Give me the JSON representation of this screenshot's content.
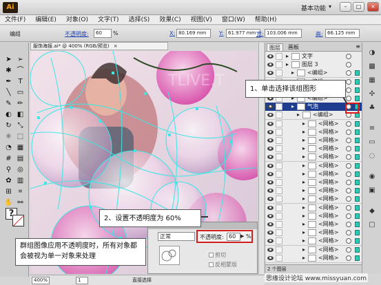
{
  "app": {
    "logo": "Ai",
    "layout_label": "基本功能",
    "window_buttons": {
      "minimize": "–",
      "maximize": "□",
      "close": "×"
    }
  },
  "menu": [
    "文件(F)",
    "编辑(E)",
    "对象(O)",
    "文字(T)",
    "选择(S)",
    "效果(C)",
    "视图(V)",
    "窗口(W)",
    "帮助(H)"
  ],
  "control_bar": {
    "selection_label": "编组",
    "opacity_label": "不透明度:",
    "opacity_value": "60",
    "opacity_unit": "%",
    "x_label": "X:",
    "x_value": "80.169 mm",
    "y_label": "Y:",
    "y_value": "61.977 mm",
    "w_label": "宽:",
    "w_value": "103.006 mm",
    "h_label": "高:",
    "h_value": "66.125 mm"
  },
  "document": {
    "tab_title": "服饰海报.ai* @ 400% (RGB/预览)",
    "tab_close": "×",
    "canvas_watermark": "TLIVE.T",
    "zoom": "400%",
    "page": "1",
    "status": "直接选择"
  },
  "layers_panel": {
    "tabs": [
      "图层",
      "画板"
    ],
    "menu_icon": "≡",
    "rows": [
      {
        "name": "文字",
        "indent": 0,
        "highlight": false
      },
      {
        "name": "图层 3",
        "indent": 0,
        "highlight": false
      },
      {
        "name": "<编组>",
        "indent": 1,
        "highlight": false
      },
      {
        "name": "<编组>",
        "indent": 1,
        "highlight": false
      },
      {
        "name": "<编组>",
        "indent": 1,
        "highlight": false
      },
      {
        "name": "<编组>",
        "indent": 1,
        "highlight": false
      },
      {
        "name": "气泡",
        "indent": 1,
        "highlight": true
      },
      {
        "name": "<编组>",
        "indent": 2,
        "highlight": false
      },
      {
        "name": "<网格>",
        "indent": 3,
        "highlight": false
      },
      {
        "name": "<网格>",
        "indent": 3,
        "highlight": false
      },
      {
        "name": "<网格>",
        "indent": 3,
        "highlight": false
      },
      {
        "name": "<网格>",
        "indent": 3,
        "highlight": false
      },
      {
        "name": "<网格>",
        "indent": 3,
        "highlight": false
      },
      {
        "name": "<网格>",
        "indent": 3,
        "highlight": false
      },
      {
        "name": "<网格>",
        "indent": 3,
        "highlight": false
      },
      {
        "name": "<网格>",
        "indent": 3,
        "highlight": false
      },
      {
        "name": "<网格>",
        "indent": 3,
        "highlight": false
      },
      {
        "name": "<网格>",
        "indent": 3,
        "highlight": false
      },
      {
        "name": "<网格>",
        "indent": 3,
        "highlight": false
      },
      {
        "name": "<网格>",
        "indent": 3,
        "highlight": false
      },
      {
        "name": "<网格>",
        "indent": 3,
        "highlight": false
      },
      {
        "name": "<网格>",
        "indent": 3,
        "highlight": false
      },
      {
        "name": "<网格>",
        "indent": 3,
        "highlight": false
      },
      {
        "name": "<网格>",
        "indent": 3,
        "highlight": false
      },
      {
        "name": "<网格>",
        "indent": 3,
        "highlight": false
      }
    ],
    "footer": "2 个图层"
  },
  "transparency_panel": {
    "blend_mode": "正常",
    "opacity_label": "不透明度:",
    "opacity_value": "60",
    "opacity_unit": "%",
    "clip_label": "剪切",
    "invert_label": "反相蒙版"
  },
  "callouts": {
    "step1": "1、单击选择该组图形",
    "step2": "2、设置不透明度为 60%",
    "note": "群组图像应用不透明度时，所有对象都会被视为单一对象来处理"
  },
  "watermark": "思缘设计论坛 www.missyuan.com",
  "colors": {
    "selection_cyan": "#3fe6e6",
    "highlight_row": "#1e3d8f",
    "annotation_red": "#e01818"
  }
}
